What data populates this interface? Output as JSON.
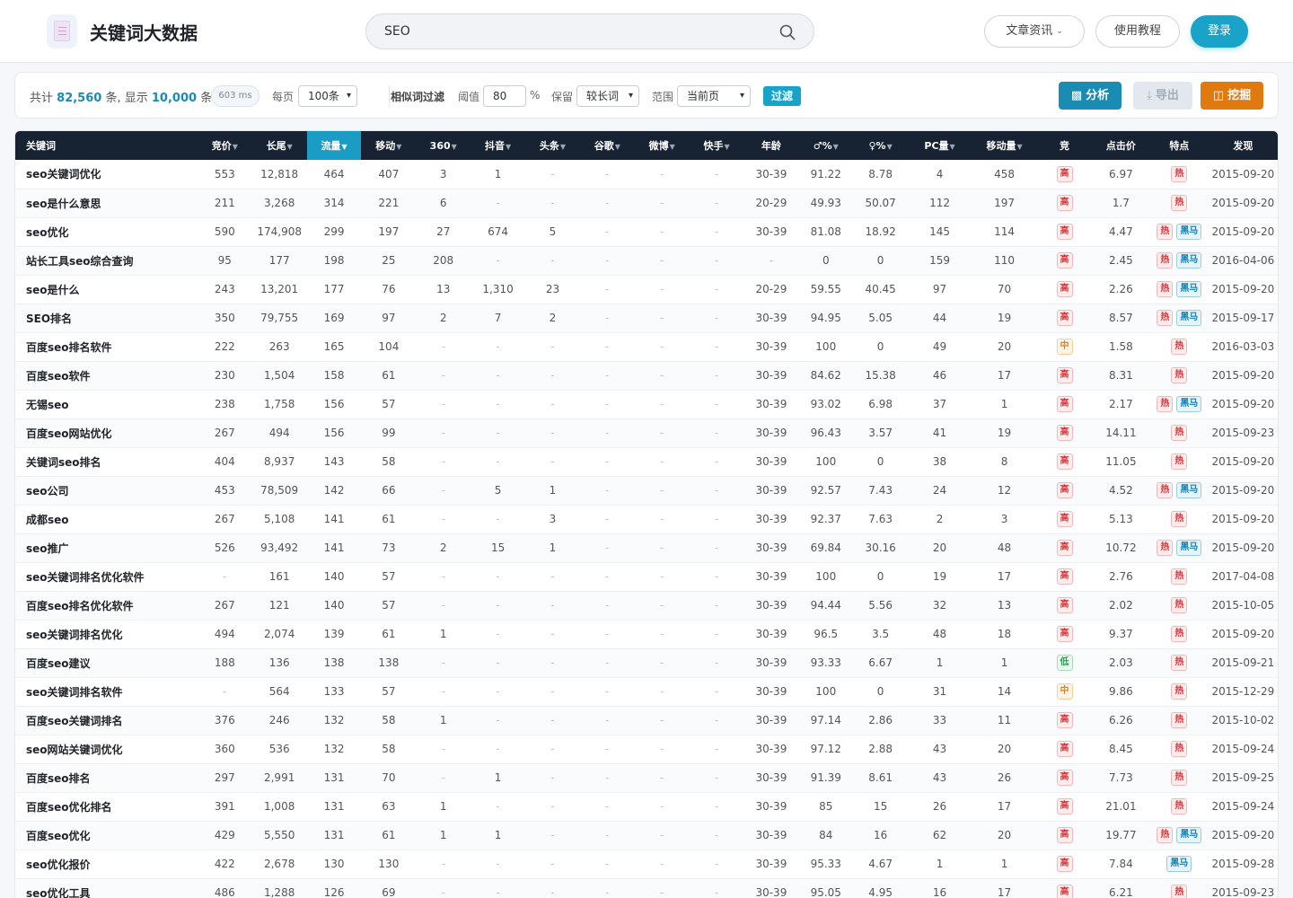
{
  "app": {
    "title": "关键词大数据",
    "logo_icon": "document-icon"
  },
  "search": {
    "value": "SEO"
  },
  "header_buttons": {
    "articles": "文章资讯",
    "tutorial": "使用教程",
    "login": "登录"
  },
  "colors": {
    "accent": "#1aa3c9",
    "header_dark": "#172233",
    "analyze": "#1a8cb3",
    "dig": "#e07a10",
    "danger": "#e0353b"
  },
  "filter": {
    "total_prefix": "共计",
    "total": "82,560",
    "total_unit": "条, 显示",
    "shown": "10,000",
    "shown_unit": "条",
    "timing": "603 ms",
    "per_page_label": "每页",
    "per_page": "100条",
    "similar_label": "相似词过滤",
    "threshold_label": "阈值",
    "threshold": "80",
    "percent": "%",
    "keep_label": "保留",
    "keep": "较长词",
    "scope_label": "范围",
    "scope": "当前页",
    "filter_button": "过滤",
    "analyze": "分析",
    "export": "导出",
    "dig": "挖掘"
  },
  "table": {
    "columns": [
      "关键词",
      "竞价",
      "长尾",
      "流量",
      "移动",
      "360",
      "抖音",
      "头条",
      "谷歌",
      "微博",
      "快手",
      "年龄",
      "♂%",
      "♀%",
      "PC量",
      "移动量",
      "竞",
      "点击价",
      "特点",
      "发现"
    ],
    "rows": [
      {
        "kw": "seo关键词优化",
        "bid": "553",
        "tail": "12,818",
        "flow": "464",
        "mobile": "407",
        "s360": "3",
        "douyin": "1",
        "toutiao": "-",
        "google": "-",
        "weibo": "-",
        "kuaishou": "-",
        "age": "30-39",
        "male": "91.22",
        "female": "8.78",
        "pc": "4",
        "mvol": "458",
        "comp": "高",
        "price": "6.97",
        "feat": [
          "热"
        ],
        "date": "2015-09-20"
      },
      {
        "kw": "seo是什么意思",
        "bid": "211",
        "tail": "3,268",
        "flow": "314",
        "mobile": "221",
        "s360": "6",
        "douyin": "-",
        "toutiao": "-",
        "google": "-",
        "weibo": "-",
        "kuaishou": "-",
        "age": "20-29",
        "male": "49.93",
        "female": "50.07",
        "pc": "112",
        "mvol": "197",
        "comp": "高",
        "price": "1.7",
        "feat": [
          "热"
        ],
        "date": "2015-09-20"
      },
      {
        "kw": "seo优化",
        "bid": "590",
        "tail": "174,908",
        "flow": "299",
        "mobile": "197",
        "s360": "27",
        "douyin": "674",
        "toutiao": "5",
        "google": "-",
        "weibo": "-",
        "kuaishou": "-",
        "age": "30-39",
        "male": "81.08",
        "female": "18.92",
        "pc": "145",
        "mvol": "114",
        "comp": "高",
        "price": "4.47",
        "feat": [
          "热",
          "黑马"
        ],
        "date": "2015-09-20"
      },
      {
        "kw": "站长工具seo综合查询",
        "bid": "95",
        "tail": "177",
        "flow": "198",
        "mobile": "25",
        "s360": "208",
        "douyin": "-",
        "toutiao": "-",
        "google": "-",
        "weibo": "-",
        "kuaishou": "-",
        "age": "-",
        "male": "0",
        "female": "0",
        "pc": "159",
        "mvol": "110",
        "comp": "高",
        "price": "2.45",
        "feat": [
          "热",
          "黑马"
        ],
        "date": "2016-04-06"
      },
      {
        "kw": "seo是什么",
        "bid": "243",
        "tail": "13,201",
        "flow": "177",
        "mobile": "76",
        "s360": "13",
        "douyin": "1,310",
        "toutiao": "23",
        "google": "-",
        "weibo": "-",
        "kuaishou": "-",
        "age": "20-29",
        "male": "59.55",
        "female": "40.45",
        "pc": "97",
        "mvol": "70",
        "comp": "高",
        "price": "2.26",
        "feat": [
          "热",
          "黑马"
        ],
        "date": "2015-09-20"
      },
      {
        "kw": "SEO排名",
        "bid": "350",
        "tail": "79,755",
        "flow": "169",
        "mobile": "97",
        "s360": "2",
        "douyin": "7",
        "toutiao": "2",
        "google": "-",
        "weibo": "-",
        "kuaishou": "-",
        "age": "30-39",
        "male": "94.95",
        "female": "5.05",
        "pc": "44",
        "mvol": "19",
        "comp": "高",
        "price": "8.57",
        "feat": [
          "热",
          "黑马"
        ],
        "date": "2015-09-17"
      },
      {
        "kw": "百度seo排名软件",
        "bid": "222",
        "tail": "263",
        "flow": "165",
        "mobile": "104",
        "s360": "-",
        "douyin": "-",
        "toutiao": "-",
        "google": "-",
        "weibo": "-",
        "kuaishou": "-",
        "age": "30-39",
        "male": "100",
        "female": "0",
        "pc": "49",
        "mvol": "20",
        "comp": "中",
        "price": "1.58",
        "feat": [
          "热"
        ],
        "date": "2016-03-03"
      },
      {
        "kw": "百度seo软件",
        "bid": "230",
        "tail": "1,504",
        "flow": "158",
        "mobile": "61",
        "s360": "-",
        "douyin": "-",
        "toutiao": "-",
        "google": "-",
        "weibo": "-",
        "kuaishou": "-",
        "age": "30-39",
        "male": "84.62",
        "female": "15.38",
        "pc": "46",
        "mvol": "17",
        "comp": "高",
        "price": "8.31",
        "feat": [
          "热"
        ],
        "date": "2015-09-20"
      },
      {
        "kw": "无锡seo",
        "bid": "238",
        "tail": "1,758",
        "flow": "156",
        "mobile": "57",
        "s360": "-",
        "douyin": "-",
        "toutiao": "-",
        "google": "-",
        "weibo": "-",
        "kuaishou": "-",
        "age": "30-39",
        "male": "93.02",
        "female": "6.98",
        "pc": "37",
        "mvol": "1",
        "comp": "高",
        "price": "2.17",
        "feat": [
          "热",
          "黑马"
        ],
        "date": "2015-09-20"
      },
      {
        "kw": "百度seo网站优化",
        "bid": "267",
        "tail": "494",
        "flow": "156",
        "mobile": "99",
        "s360": "-",
        "douyin": "-",
        "toutiao": "-",
        "google": "-",
        "weibo": "-",
        "kuaishou": "-",
        "age": "30-39",
        "male": "96.43",
        "female": "3.57",
        "pc": "41",
        "mvol": "19",
        "comp": "高",
        "price": "14.11",
        "feat": [
          "热"
        ],
        "date": "2015-09-23"
      },
      {
        "kw": "关键词seo排名",
        "bid": "404",
        "tail": "8,937",
        "flow": "143",
        "mobile": "58",
        "s360": "-",
        "douyin": "-",
        "toutiao": "-",
        "google": "-",
        "weibo": "-",
        "kuaishou": "-",
        "age": "30-39",
        "male": "100",
        "female": "0",
        "pc": "38",
        "mvol": "8",
        "comp": "高",
        "price": "11.05",
        "feat": [
          "热"
        ],
        "date": "2015-09-20"
      },
      {
        "kw": "seo公司",
        "bid": "453",
        "tail": "78,509",
        "flow": "142",
        "mobile": "66",
        "s360": "-",
        "douyin": "5",
        "toutiao": "1",
        "google": "-",
        "weibo": "-",
        "kuaishou": "-",
        "age": "30-39",
        "male": "92.57",
        "female": "7.43",
        "pc": "24",
        "mvol": "12",
        "comp": "高",
        "price": "4.52",
        "feat": [
          "热",
          "黑马"
        ],
        "date": "2015-09-20"
      },
      {
        "kw": "成都seo",
        "bid": "267",
        "tail": "5,108",
        "flow": "141",
        "mobile": "61",
        "s360": "-",
        "douyin": "-",
        "toutiao": "3",
        "google": "-",
        "weibo": "-",
        "kuaishou": "-",
        "age": "30-39",
        "male": "92.37",
        "female": "7.63",
        "pc": "2",
        "mvol": "3",
        "comp": "高",
        "price": "5.13",
        "feat": [
          "热"
        ],
        "date": "2015-09-20"
      },
      {
        "kw": "seo推广",
        "bid": "526",
        "tail": "93,492",
        "flow": "141",
        "mobile": "73",
        "s360": "2",
        "douyin": "15",
        "toutiao": "1",
        "google": "-",
        "weibo": "-",
        "kuaishou": "-",
        "age": "30-39",
        "male": "69.84",
        "female": "30.16",
        "pc": "20",
        "mvol": "48",
        "comp": "高",
        "price": "10.72",
        "feat": [
          "热",
          "黑马"
        ],
        "date": "2015-09-20"
      },
      {
        "kw": "seo关键词排名优化软件",
        "bid": "-",
        "tail": "161",
        "flow": "140",
        "mobile": "57",
        "s360": "-",
        "douyin": "-",
        "toutiao": "-",
        "google": "-",
        "weibo": "-",
        "kuaishou": "-",
        "age": "30-39",
        "male": "100",
        "female": "0",
        "pc": "19",
        "mvol": "17",
        "comp": "高",
        "price": "2.76",
        "feat": [
          "热"
        ],
        "date": "2017-04-08"
      },
      {
        "kw": "百度seo排名优化软件",
        "bid": "267",
        "tail": "121",
        "flow": "140",
        "mobile": "57",
        "s360": "-",
        "douyin": "-",
        "toutiao": "-",
        "google": "-",
        "weibo": "-",
        "kuaishou": "-",
        "age": "30-39",
        "male": "94.44",
        "female": "5.56",
        "pc": "32",
        "mvol": "13",
        "comp": "高",
        "price": "2.02",
        "feat": [
          "热"
        ],
        "date": "2015-10-05"
      },
      {
        "kw": "seo关键词排名优化",
        "bid": "494",
        "tail": "2,074",
        "flow": "139",
        "mobile": "61",
        "s360": "1",
        "douyin": "-",
        "toutiao": "-",
        "google": "-",
        "weibo": "-",
        "kuaishou": "-",
        "age": "30-39",
        "male": "96.5",
        "female": "3.5",
        "pc": "48",
        "mvol": "18",
        "comp": "高",
        "price": "9.37",
        "feat": [
          "热"
        ],
        "date": "2015-09-20"
      },
      {
        "kw": "百度seo建议",
        "bid": "188",
        "tail": "136",
        "flow": "138",
        "mobile": "138",
        "s360": "-",
        "douyin": "-",
        "toutiao": "-",
        "google": "-",
        "weibo": "-",
        "kuaishou": "-",
        "age": "30-39",
        "male": "93.33",
        "female": "6.67",
        "pc": "1",
        "mvol": "1",
        "comp": "低",
        "price": "2.03",
        "feat": [
          "热"
        ],
        "date": "2015-09-21"
      },
      {
        "kw": "seo关键词排名软件",
        "bid": "-",
        "tail": "564",
        "flow": "133",
        "mobile": "57",
        "s360": "-",
        "douyin": "-",
        "toutiao": "-",
        "google": "-",
        "weibo": "-",
        "kuaishou": "-",
        "age": "30-39",
        "male": "100",
        "female": "0",
        "pc": "31",
        "mvol": "14",
        "comp": "中",
        "price": "9.86",
        "feat": [
          "热"
        ],
        "date": "2015-12-29"
      },
      {
        "kw": "百度seo关键词排名",
        "bid": "376",
        "tail": "246",
        "flow": "132",
        "mobile": "58",
        "s360": "1",
        "douyin": "-",
        "toutiao": "-",
        "google": "-",
        "weibo": "-",
        "kuaishou": "-",
        "age": "30-39",
        "male": "97.14",
        "female": "2.86",
        "pc": "33",
        "mvol": "11",
        "comp": "高",
        "price": "6.26",
        "feat": [
          "热"
        ],
        "date": "2015-10-02"
      },
      {
        "kw": "seo网站关键词优化",
        "bid": "360",
        "tail": "536",
        "flow": "132",
        "mobile": "58",
        "s360": "-",
        "douyin": "-",
        "toutiao": "-",
        "google": "-",
        "weibo": "-",
        "kuaishou": "-",
        "age": "30-39",
        "male": "97.12",
        "female": "2.88",
        "pc": "43",
        "mvol": "20",
        "comp": "高",
        "price": "8.45",
        "feat": [
          "热"
        ],
        "date": "2015-09-24"
      },
      {
        "kw": "百度seo排名",
        "bid": "297",
        "tail": "2,991",
        "flow": "131",
        "mobile": "70",
        "s360": "-",
        "douyin": "1",
        "toutiao": "-",
        "google": "-",
        "weibo": "-",
        "kuaishou": "-",
        "age": "30-39",
        "male": "91.39",
        "female": "8.61",
        "pc": "43",
        "mvol": "26",
        "comp": "高",
        "price": "7.73",
        "feat": [
          "热"
        ],
        "date": "2015-09-25"
      },
      {
        "kw": "百度seo优化排名",
        "bid": "391",
        "tail": "1,008",
        "flow": "131",
        "mobile": "63",
        "s360": "1",
        "douyin": "-",
        "toutiao": "-",
        "google": "-",
        "weibo": "-",
        "kuaishou": "-",
        "age": "30-39",
        "male": "85",
        "female": "15",
        "pc": "26",
        "mvol": "17",
        "comp": "高",
        "price": "21.01",
        "feat": [
          "热"
        ],
        "date": "2015-09-24"
      },
      {
        "kw": "百度seo优化",
        "bid": "429",
        "tail": "5,550",
        "flow": "131",
        "mobile": "61",
        "s360": "1",
        "douyin": "1",
        "toutiao": "-",
        "google": "-",
        "weibo": "-",
        "kuaishou": "-",
        "age": "30-39",
        "male": "84",
        "female": "16",
        "pc": "62",
        "mvol": "20",
        "comp": "高",
        "price": "19.77",
        "feat": [
          "热",
          "黑马"
        ],
        "date": "2015-09-20"
      },
      {
        "kw": "seo优化报价",
        "bid": "422",
        "tail": "2,678",
        "flow": "130",
        "mobile": "130",
        "s360": "-",
        "douyin": "-",
        "toutiao": "-",
        "google": "-",
        "weibo": "-",
        "kuaishou": "-",
        "age": "30-39",
        "male": "95.33",
        "female": "4.67",
        "pc": "1",
        "mvol": "1",
        "comp": "高",
        "price": "7.84",
        "feat": [
          "黑马"
        ],
        "date": "2015-09-28"
      },
      {
        "kw": "seo优化工具",
        "bid": "486",
        "tail": "1,288",
        "flow": "126",
        "mobile": "69",
        "s360": "-",
        "douyin": "-",
        "toutiao": "-",
        "google": "-",
        "weibo": "-",
        "kuaishou": "-",
        "age": "30-39",
        "male": "95.05",
        "female": "4.95",
        "pc": "16",
        "mvol": "17",
        "comp": "高",
        "price": "6.21",
        "feat": [
          "热"
        ],
        "date": "2015-09-23"
      }
    ]
  }
}
